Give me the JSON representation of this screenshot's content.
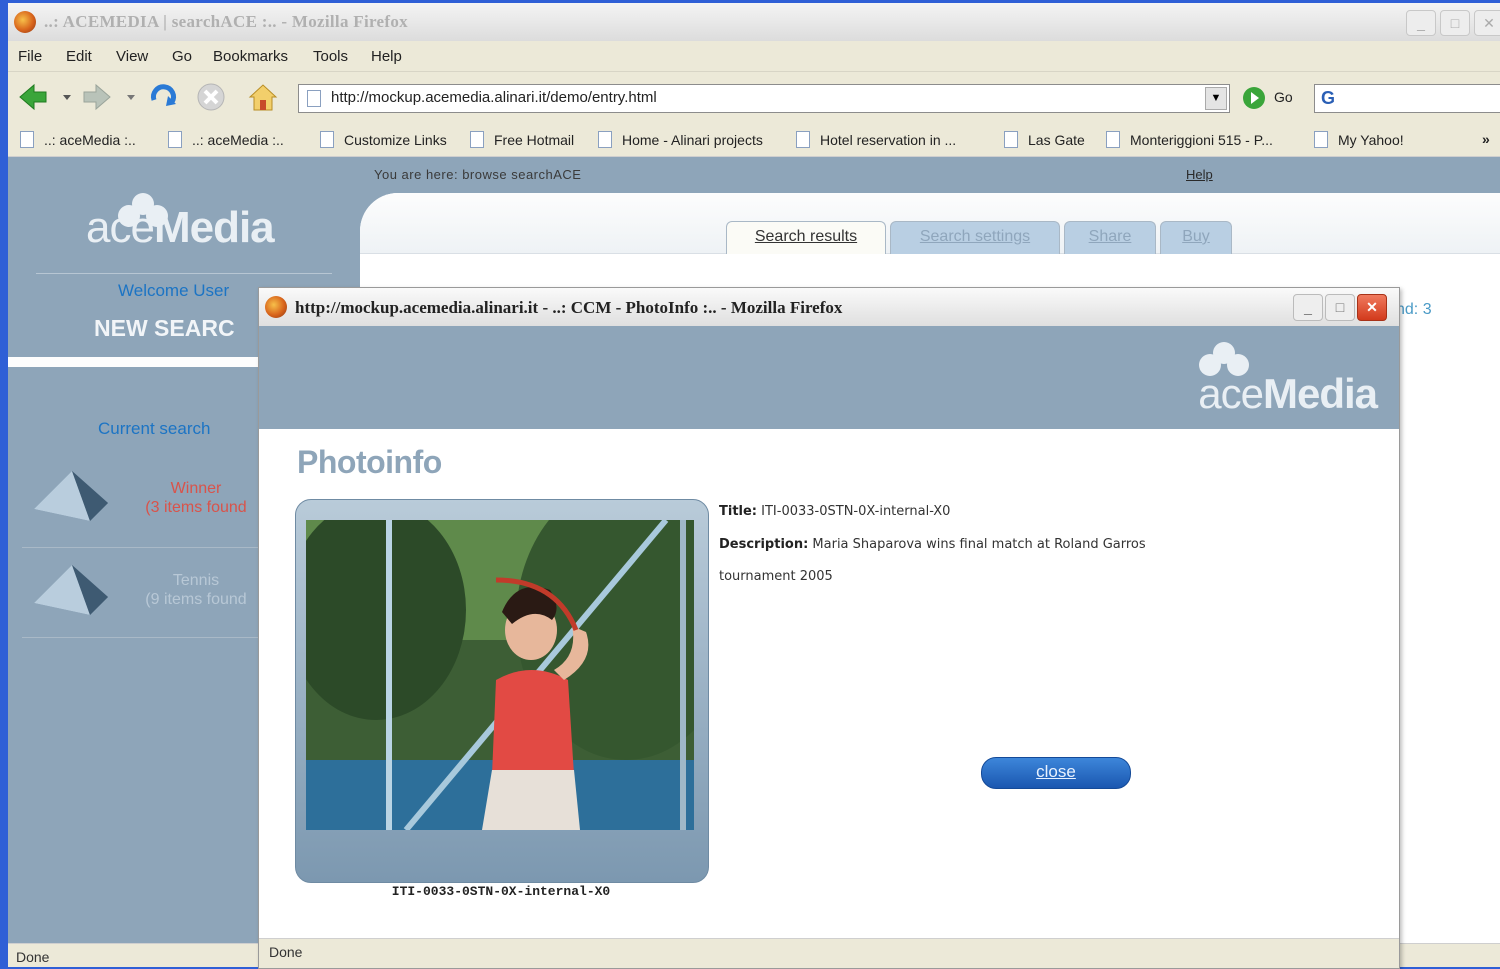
{
  "window": {
    "title": "..: ACEMEDIA | searchACE :.. - Mozilla Firefox",
    "min": "_",
    "max": "□",
    "close": "✕"
  },
  "menu": [
    "File",
    "Edit",
    "View",
    "Go",
    "Bookmarks",
    "Tools",
    "Help"
  ],
  "navbar": {
    "url": "http://mockup.acemedia.alinari.it/demo/entry.html",
    "go_label": "Go"
  },
  "bookmarks": [
    "..: aceMedia :..",
    "..: aceMedia :..",
    "Customize Links",
    "Free Hotmail",
    "Home - Alinari projects",
    "Hotel reservation in ...",
    "Las Gate",
    "Monteriggioni 515 - P...",
    "My Yahoo!"
  ],
  "bookmarks_more": "»",
  "page": {
    "breadcrumb": "You are here: browse searchACE",
    "help": "Help",
    "logo_ace": "ace",
    "logo_media": "Media",
    "welcome": "Welcome User",
    "new_search": "NEW SEARC",
    "current_search": "Current search",
    "results": [
      {
        "name": "Winner",
        "count": "(3 items found",
        "color": "#d9534a"
      },
      {
        "name": "Tennis",
        "count": "(9 items found",
        "color": "#b8c8d6"
      }
    ],
    "tabs": [
      "Search results",
      "Search settings",
      "Share",
      "Buy"
    ],
    "found_text": "nd: 3",
    "status": "Done"
  },
  "popup": {
    "title": "http://mockup.acemedia.alinari.it - ..: CCM - PhotoInfo :.. - Mozilla Firefox",
    "heading": "Photoinfo",
    "logo_ace": "ace",
    "logo_media": "Media",
    "title_label": "Title:",
    "title_value": "ITI-0033-0STN-0X-internal-X0",
    "description_label": "Description:",
    "description_line1": "Maria Shaparova wins final match at Roland Garros",
    "description_line2": "tournament 2005",
    "caption": "ITI-0033-0STN-0X-internal-X0",
    "close_label": "close",
    "status": "Done"
  },
  "colors": {
    "panel_bg": "#8ea5b9",
    "link_blue": "#1c74c4",
    "button_blue": "#1a57b0"
  }
}
